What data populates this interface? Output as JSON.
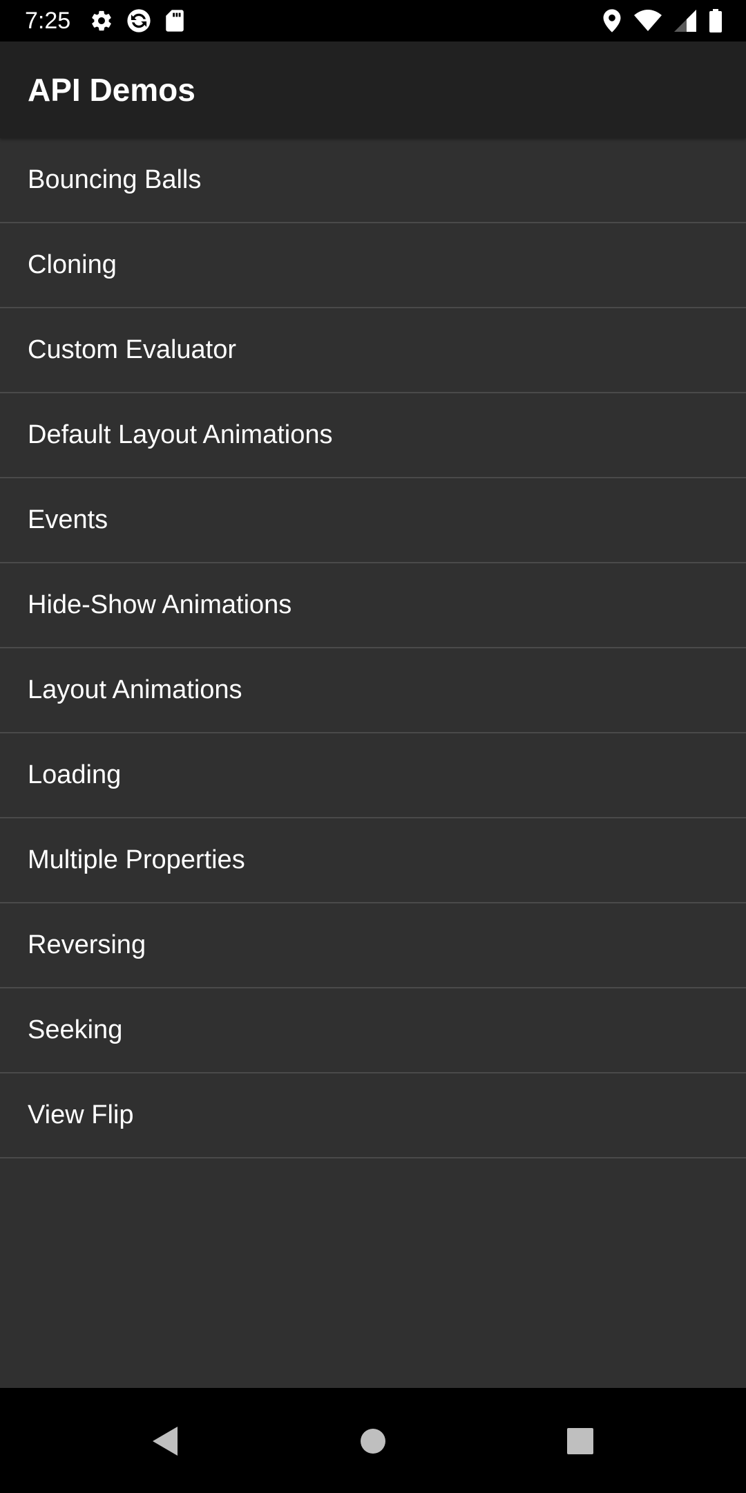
{
  "status_bar": {
    "time": "7:25",
    "left_icons": [
      "settings-icon",
      "sync-icon",
      "sd-card-icon"
    ],
    "right_icons": [
      "location-icon",
      "wifi-icon",
      "cell-signal-icon",
      "battery-icon"
    ]
  },
  "app_bar": {
    "title": "API Demos"
  },
  "list": {
    "items": [
      {
        "label": "Bouncing Balls"
      },
      {
        "label": "Cloning"
      },
      {
        "label": "Custom Evaluator"
      },
      {
        "label": "Default Layout Animations"
      },
      {
        "label": "Events"
      },
      {
        "label": "Hide-Show Animations"
      },
      {
        "label": "Layout Animations"
      },
      {
        "label": "Loading"
      },
      {
        "label": "Multiple Properties"
      },
      {
        "label": "Reversing"
      },
      {
        "label": "Seeking"
      },
      {
        "label": "View Flip"
      }
    ]
  },
  "nav_bar": {
    "buttons": [
      "back-icon",
      "home-icon",
      "recents-icon"
    ]
  },
  "colors": {
    "background": "#303030",
    "app_bar": "#212121",
    "status_bar": "#000000",
    "divider": "#4a4a4a",
    "text": "#ffffff"
  }
}
